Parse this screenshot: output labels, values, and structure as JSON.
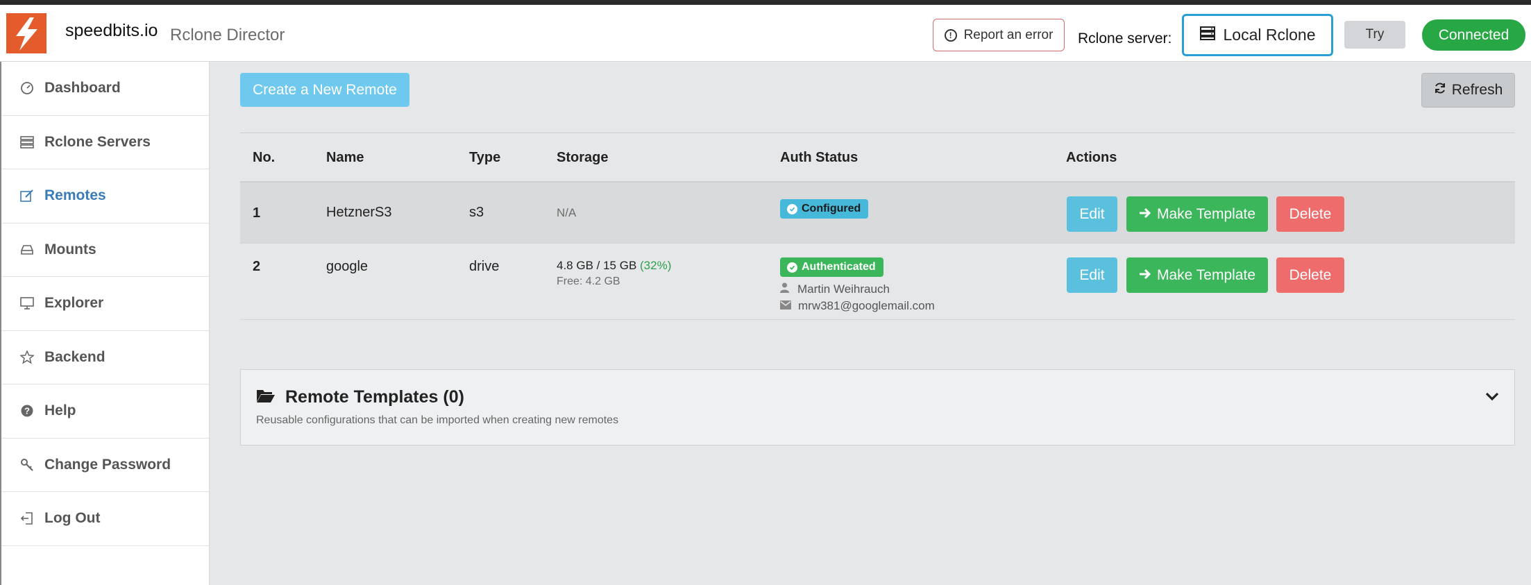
{
  "header": {
    "brand": "speedbits.io",
    "app_title": "Rclone Director",
    "report_label": "Report an error",
    "server_label": "Rclone server:",
    "server_value": "Local Rclone",
    "try_label": "Try",
    "status_label": "Connected"
  },
  "sidebar": {
    "items": [
      {
        "label": "Dashboard",
        "icon": "dashboard-icon"
      },
      {
        "label": "Rclone Servers",
        "icon": "server-icon"
      },
      {
        "label": "Remotes",
        "icon": "edit-icon",
        "active": true
      },
      {
        "label": "Mounts",
        "icon": "drive-icon"
      },
      {
        "label": "Explorer",
        "icon": "monitor-icon"
      },
      {
        "label": "Backend",
        "icon": "star-icon"
      },
      {
        "label": "Help",
        "icon": "question-icon"
      },
      {
        "label": "Change Password",
        "icon": "key-icon"
      },
      {
        "label": "Log Out",
        "icon": "logout-icon"
      }
    ]
  },
  "toolbar": {
    "create_label": "Create a New Remote",
    "refresh_label": "Refresh"
  },
  "table": {
    "headers": [
      "No.",
      "Name",
      "Type",
      "Storage",
      "Auth Status",
      "Actions"
    ],
    "rows": [
      {
        "no": "1",
        "name": "HetznerS3",
        "type": "s3",
        "storage": "N/A",
        "auth_badge": "Configured"
      },
      {
        "no": "2",
        "name": "google",
        "type": "drive",
        "storage_used": "4.8 GB / 15 GB",
        "storage_pct": "(32%)",
        "storage_free": "Free: 4.2 GB",
        "auth_badge": "Authenticated",
        "auth_user": "Martin Weihrauch",
        "auth_email": "mrw381@googlemail.com"
      }
    ],
    "actions": {
      "edit": "Edit",
      "template": "Make Template",
      "delete": "Delete"
    }
  },
  "templates": {
    "title": "Remote Templates (0)",
    "description": "Reusable configurations that can be imported when creating new remotes"
  },
  "colors": {
    "brand": "#e45b2c",
    "active_nav": "#3a7cb8",
    "success": "#28a745",
    "info": "#5bc0de",
    "danger": "#ee6c6c"
  }
}
